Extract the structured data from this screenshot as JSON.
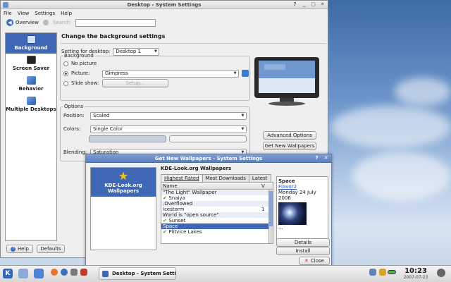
{
  "main_window": {
    "title": "Desktop - System Settings",
    "menu": [
      "File",
      "View",
      "Settings",
      "Help"
    ],
    "toolbar": {
      "overview_label": "Overview",
      "search_label": "Search:"
    },
    "sidebar": [
      {
        "label": "Background",
        "icon": "desktop-icon",
        "active": true
      },
      {
        "label": "Screen Saver",
        "icon": "monitor-icon",
        "active": false
      },
      {
        "label": "Behavior",
        "icon": "mouse-icon",
        "active": false
      },
      {
        "label": "Multiple Desktops",
        "icon": "desktops-icon",
        "active": false
      }
    ],
    "heading": "Change the background settings",
    "setting_for_label": "Setting for desktop:",
    "setting_for_value": "Desktop 1",
    "background_group": {
      "legend": "Background",
      "no_picture": "No picture",
      "picture": "Picture:",
      "picture_value": "Gimpress",
      "slide_show": "Slide show:",
      "setup_label": "Setup..."
    },
    "options_group": {
      "legend": "Options",
      "position_label": "Position:",
      "position_value": "Scaled",
      "colors_label": "Colors:",
      "colors_value": "Single Color",
      "blending_label": "Blending:",
      "blending_value": "Saturation"
    },
    "buttons": {
      "advanced": "Advanced Options",
      "get_new": "Get New Wallpapers",
      "help": "Help",
      "defaults": "Defaults"
    }
  },
  "dialog": {
    "title": "Get New Wallpapers - System Settings",
    "provider": "KDE-Look.org Wallpapers",
    "heading": "KDE-Look.org Wallpapers",
    "tabs": [
      "Highest Rated",
      "Most Downloads",
      "Latest"
    ],
    "column_name": "Name",
    "column_v": "V",
    "items": [
      {
        "name": "\"The Light\" Wallpaper",
        "installed": false,
        "rating": ""
      },
      {
        "name": "Snaiya",
        "installed": true,
        "rating": ""
      },
      {
        "name": ".Overflowed",
        "installed": false,
        "rating": ""
      },
      {
        "name": "Icestorm",
        "installed": false,
        "rating": "1"
      },
      {
        "name": "World is \"open source\"",
        "installed": false,
        "rating": ""
      },
      {
        "name": "Sunset",
        "installed": true,
        "rating": ""
      },
      {
        "name": "Space",
        "installed": false,
        "rating": "",
        "selected": true
      },
      {
        "name": "Plitvice Lakes",
        "installed": true,
        "rating": ""
      }
    ],
    "detail": {
      "title": "Space",
      "author": "Flavor2",
      "date": "Monday 24 July 2006",
      "ellipsis": "..."
    },
    "buttons": {
      "details": "Details",
      "install": "Install",
      "close": "Close"
    }
  },
  "taskbar": {
    "task_label": "Desktop - System Settin",
    "clock_time": "10:23",
    "clock_date": "2007-07-23"
  },
  "colors": {
    "accent": "#4067b5",
    "installed_check": "#2f9b2f",
    "desktop_sky": "#6b94c9"
  }
}
